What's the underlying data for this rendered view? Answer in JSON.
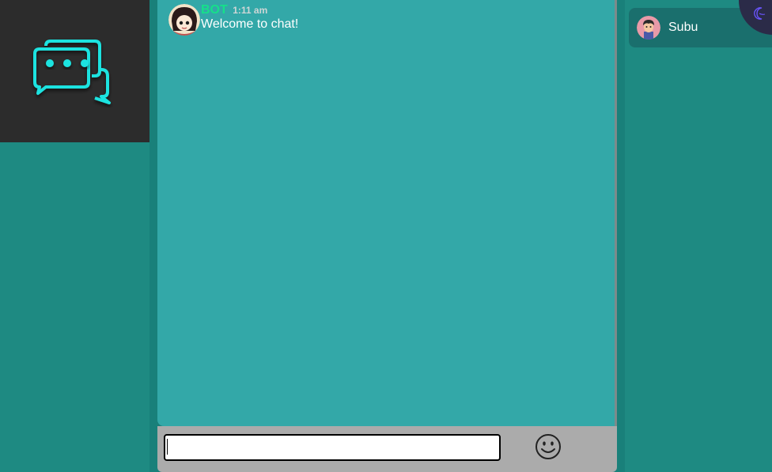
{
  "logo": {
    "icon": "chat-bubbles-icon",
    "color": "#1fe3e0"
  },
  "chat": {
    "messages": [
      {
        "user": "BOT",
        "time": "1:11 am",
        "text": "Welcome to chat!",
        "avatar_icon": "bot-avatar-icon"
      }
    ],
    "input": {
      "value": "",
      "placeholder": ""
    },
    "emoji_icon": "smiley-emoji-icon"
  },
  "users": [
    {
      "name": "Subu",
      "avatar_icon": "user-avatar-icon"
    }
  ],
  "theme_toggle": {
    "icon": "moon-icon"
  },
  "colors": {
    "background": "#1e8a82",
    "chat_area": "#33a8a8",
    "logo_panel": "#2c2c2c",
    "username": "#16e08a",
    "input_bar": "#ababab",
    "user_item": "#1a6f6d"
  }
}
